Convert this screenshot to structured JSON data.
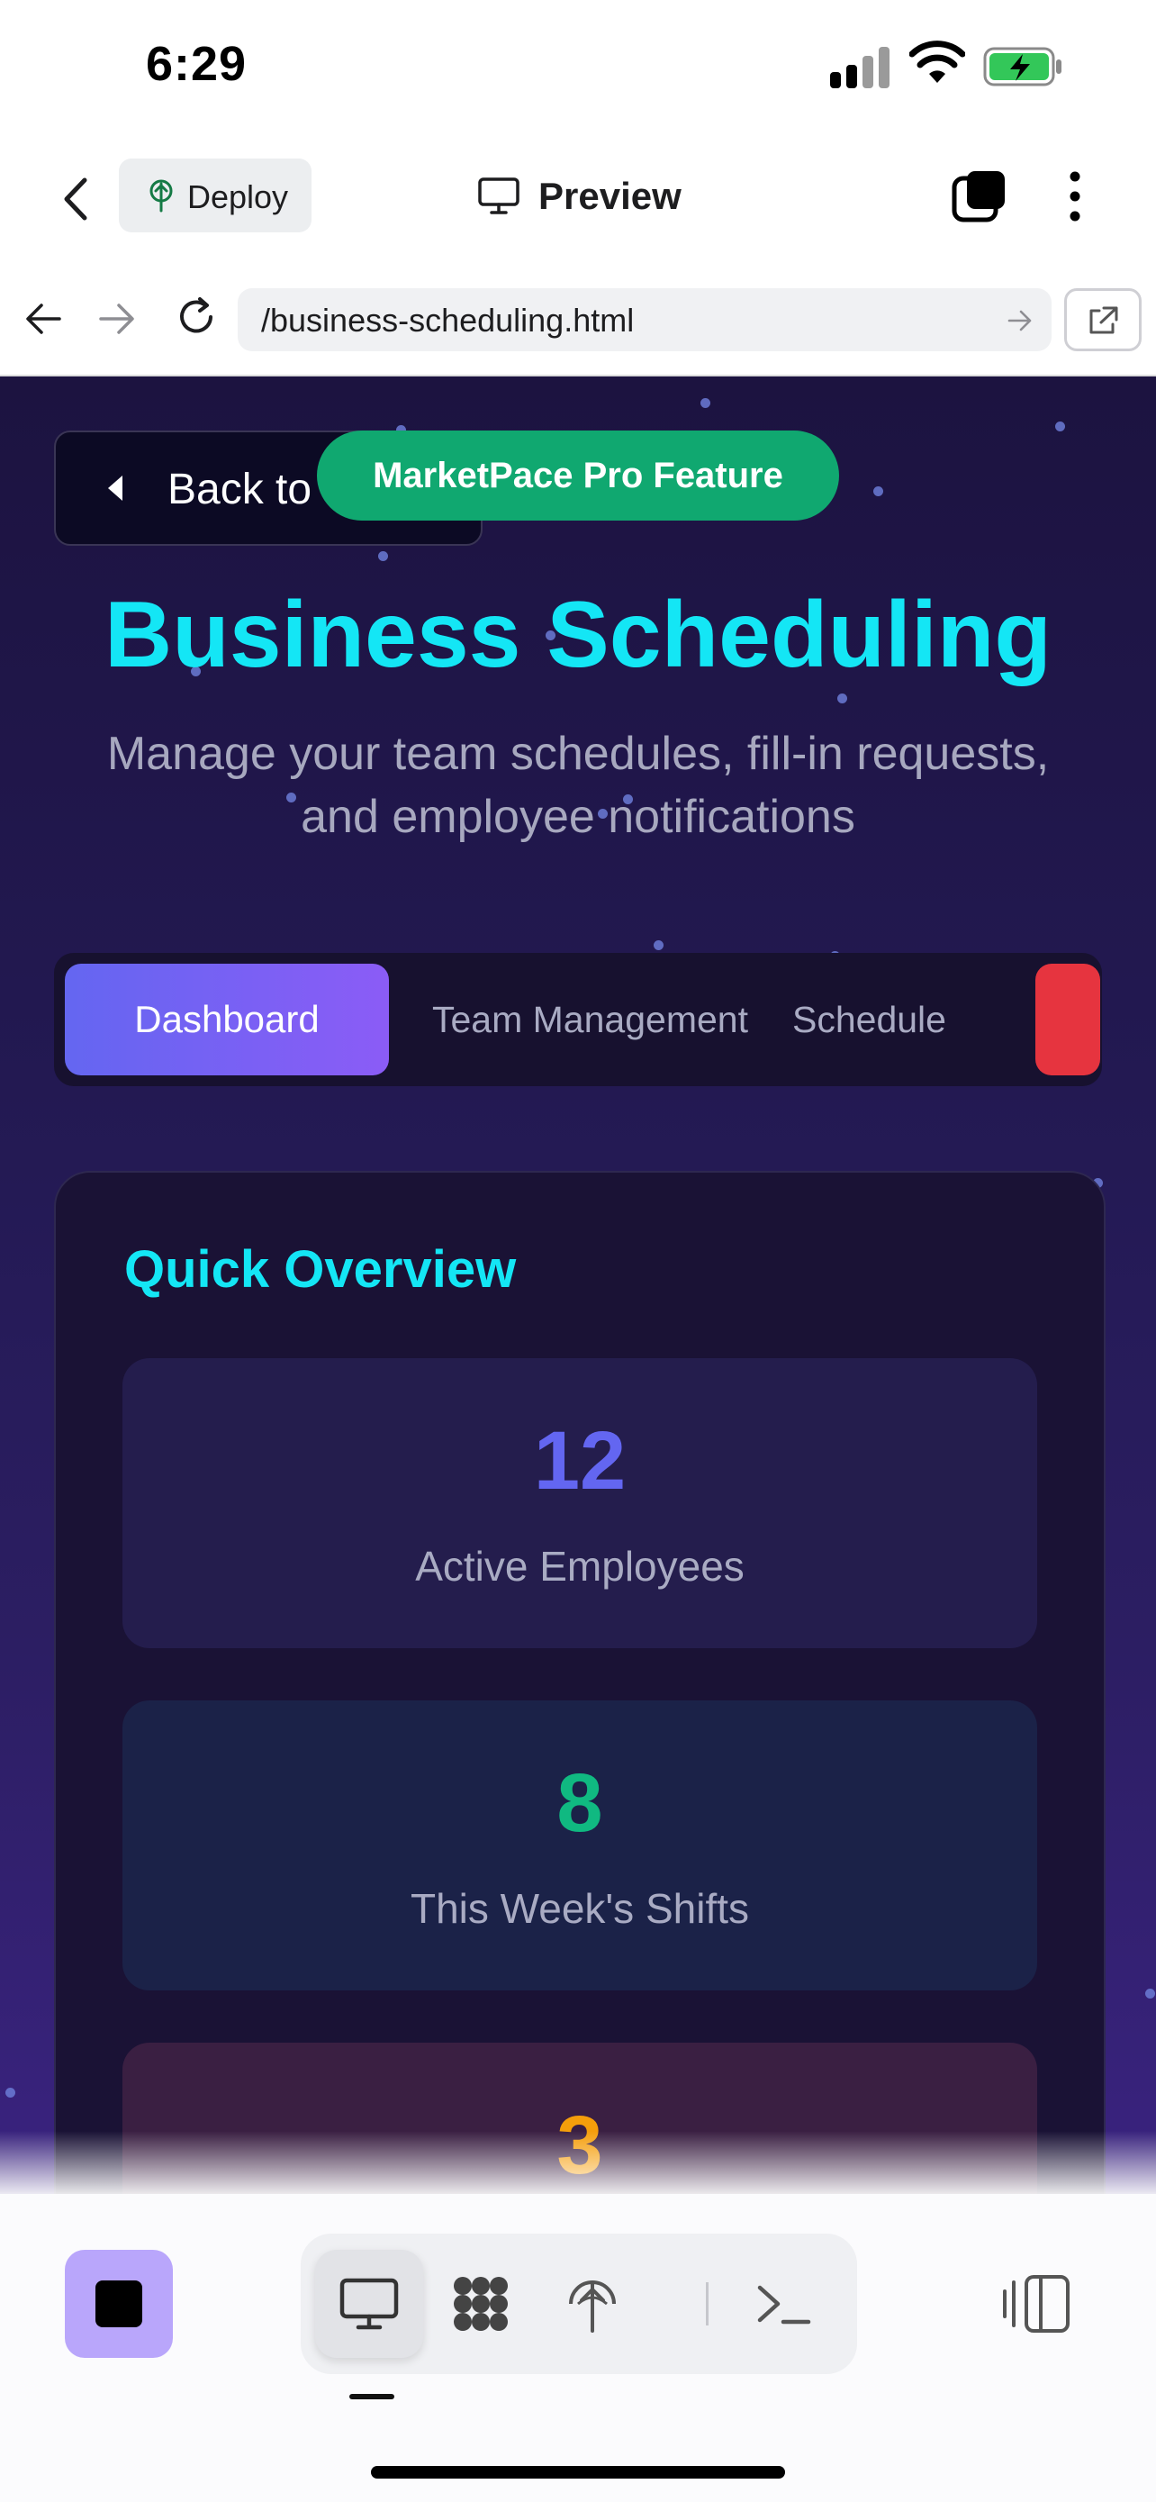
{
  "status_bar": {
    "time": "6:29"
  },
  "header": {
    "back_icon": "chevron-left-icon",
    "deploy_label": "Deploy",
    "preview_label": "Preview",
    "tabs_icon": "tabs-icon",
    "more_icon": "more-vertical-icon"
  },
  "browser": {
    "url": "/business-scheduling.html"
  },
  "page": {
    "back_label": "Back to",
    "pro_badge": "MarketPace Pro Feature",
    "title": "Business Scheduling",
    "subtitle": "Manage your team schedules, fill-in requests, and employee notifications",
    "tabs": [
      {
        "label": "Dashboard",
        "active": true
      },
      {
        "label": "Team Management",
        "active": false
      },
      {
        "label": "Schedule",
        "active": false
      }
    ],
    "overview": {
      "title": "Quick Overview",
      "stats": [
        {
          "value": "12",
          "label": "Active Employees",
          "color": "#6366f1"
        },
        {
          "value": "8",
          "label": "This Week's Shifts",
          "color": "#10b981"
        },
        {
          "value": "3",
          "label": "",
          "color": "#f59e0b"
        }
      ]
    }
  },
  "colors": {
    "accent_cyan": "#14e6f5",
    "badge_green": "#10a870",
    "tab_gradient_start": "#6466f1",
    "tab_gradient_end": "#8b5cf6",
    "danger_red": "#e6343f",
    "stop_button": "#b9a6fb"
  },
  "toolbar": {
    "stop_icon": "stop-icon",
    "tools": [
      "monitor-icon",
      "apps-grid-icon",
      "deploy-icon",
      "terminal-icon"
    ],
    "panel_icon": "panel-toggle-icon"
  }
}
